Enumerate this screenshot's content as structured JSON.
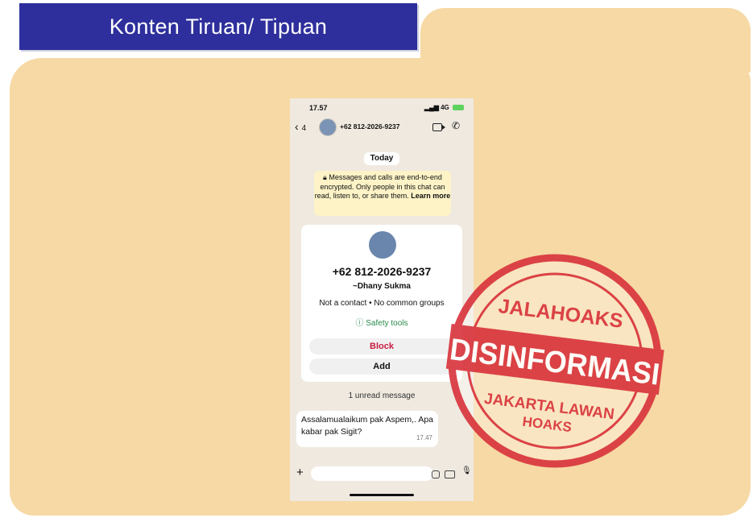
{
  "header": {
    "title": "Konten Tiruan/ Tipuan"
  },
  "phone": {
    "status_time": "17.57",
    "status_signal": "4G",
    "back_count": "4",
    "contact_number": "+62 812-2026-9237",
    "date_chip": "Today",
    "encryption_text": "Messages and calls are end-to-end encrypted. Only people in this chat can read, listen to, or share them.",
    "encryption_link": "Learn more",
    "profile_number": "+62 812-2026-9237",
    "profile_name": "~Dhany Sukma",
    "profile_meta": "Not a contact • No common groups",
    "safety_tools": "Safety tools",
    "block_label": "Block",
    "add_label": "Add",
    "unread_label": "1 unread message",
    "message_text": "Assalamualaikum pak Aspem,. Apa kabar pak Sigit?",
    "message_time": "17.47"
  },
  "stamp": {
    "top_text": "JALAHOAKS",
    "main_text": "DISINFORMASI",
    "bottom_line1": "JAKARTA LAWAN",
    "bottom_line2": "HOAKS",
    "color": "#d9363e"
  },
  "colors": {
    "title_bg": "#2e2f9c",
    "folder": "#f6d9a4"
  }
}
